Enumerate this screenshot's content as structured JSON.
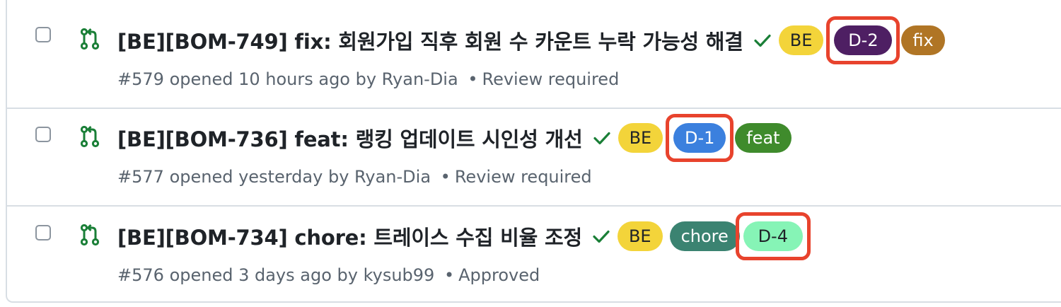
{
  "pull_requests": [
    {
      "title": "[BE][BOM-749] fix: 회원가입 직후 회원 수 카운트 누락 가능성 해결",
      "meta": {
        "number": "#579",
        "opened": "opened 10 hours ago by Ryan-Dia",
        "separator": "•",
        "review": "Review required"
      },
      "labels": [
        {
          "text": "BE",
          "bg": "#f3d43a",
          "fg": "#1f2328"
        },
        {
          "text": "D-2",
          "bg": "#4e1f63",
          "fg": "#ffffff",
          "highlighted": true
        },
        {
          "text": "fix",
          "bg": "#b07525",
          "fg": "#ffffff"
        }
      ]
    },
    {
      "title": "[BE][BOM-736] feat: 랭킹 업데이트 시인성 개선",
      "meta": {
        "number": "#577",
        "opened": "opened yesterday by Ryan-Dia",
        "separator": "•",
        "review": "Review required"
      },
      "labels": [
        {
          "text": "BE",
          "bg": "#f3d43a",
          "fg": "#1f2328"
        },
        {
          "text": "D-1",
          "bg": "#3b80de",
          "fg": "#ffffff",
          "highlighted": true
        },
        {
          "text": "feat",
          "bg": "#3f8b2c",
          "fg": "#ffffff"
        }
      ]
    },
    {
      "title": "[BE][BOM-734] chore: 트레이스 수집 비율 조정",
      "meta": {
        "number": "#576",
        "opened": "opened 3 days ago by kysub99",
        "separator": "•",
        "review": "Approved"
      },
      "labels": [
        {
          "text": "BE",
          "bg": "#f3d43a",
          "fg": "#1f2328"
        },
        {
          "text": "chore",
          "bg": "#3b8371",
          "fg": "#ffffff"
        },
        {
          "text": "D-4",
          "bg": "#86f4b6",
          "fg": "#1f2328",
          "highlighted": true
        }
      ]
    }
  ],
  "icons": {
    "pr": "git-pull-request-icon",
    "status": "check-icon"
  },
  "colors": {
    "pr_icon": "#1a7f37",
    "check": "#1a7f37",
    "highlight_box": "#e8432d"
  }
}
